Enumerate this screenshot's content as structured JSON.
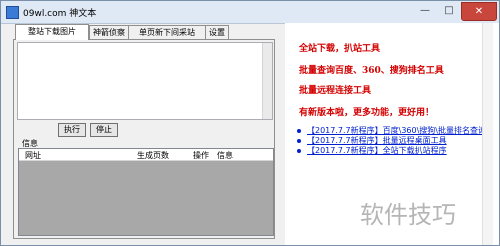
{
  "window": {
    "title": "09wl.com 神文本",
    "minimize": "—",
    "maximize": "□",
    "close": "✕"
  },
  "tabs": [
    "整站下载图片",
    "神箭侦察",
    "单页新下间采站",
    "设置"
  ],
  "panel": {
    "run_label": "执行",
    "stop_label": "停止",
    "info_label": "信息"
  },
  "list": {
    "columns": [
      "网址",
      "生成页数",
      "操作",
      "信息"
    ]
  },
  "right": {
    "headlines": [
      "全站下载，扒站工具",
      "批量查询百度、360、搜狗排名工具",
      "批量远程连接工具",
      "有新版本啦，更多功能，更好用！"
    ],
    "links": [
      "【2017.7.7新程序】百度\\360\\搜狗\\批量排名查询",
      "【2017.7.7新程序】批量远程桌面工具",
      "【2017.7.7新程序】全站下载扒站程序"
    ]
  },
  "watermark": "软件技巧",
  "colors": {
    "headline": "#d40000",
    "link": "#0020d0",
    "close_button": "#c9463d"
  }
}
